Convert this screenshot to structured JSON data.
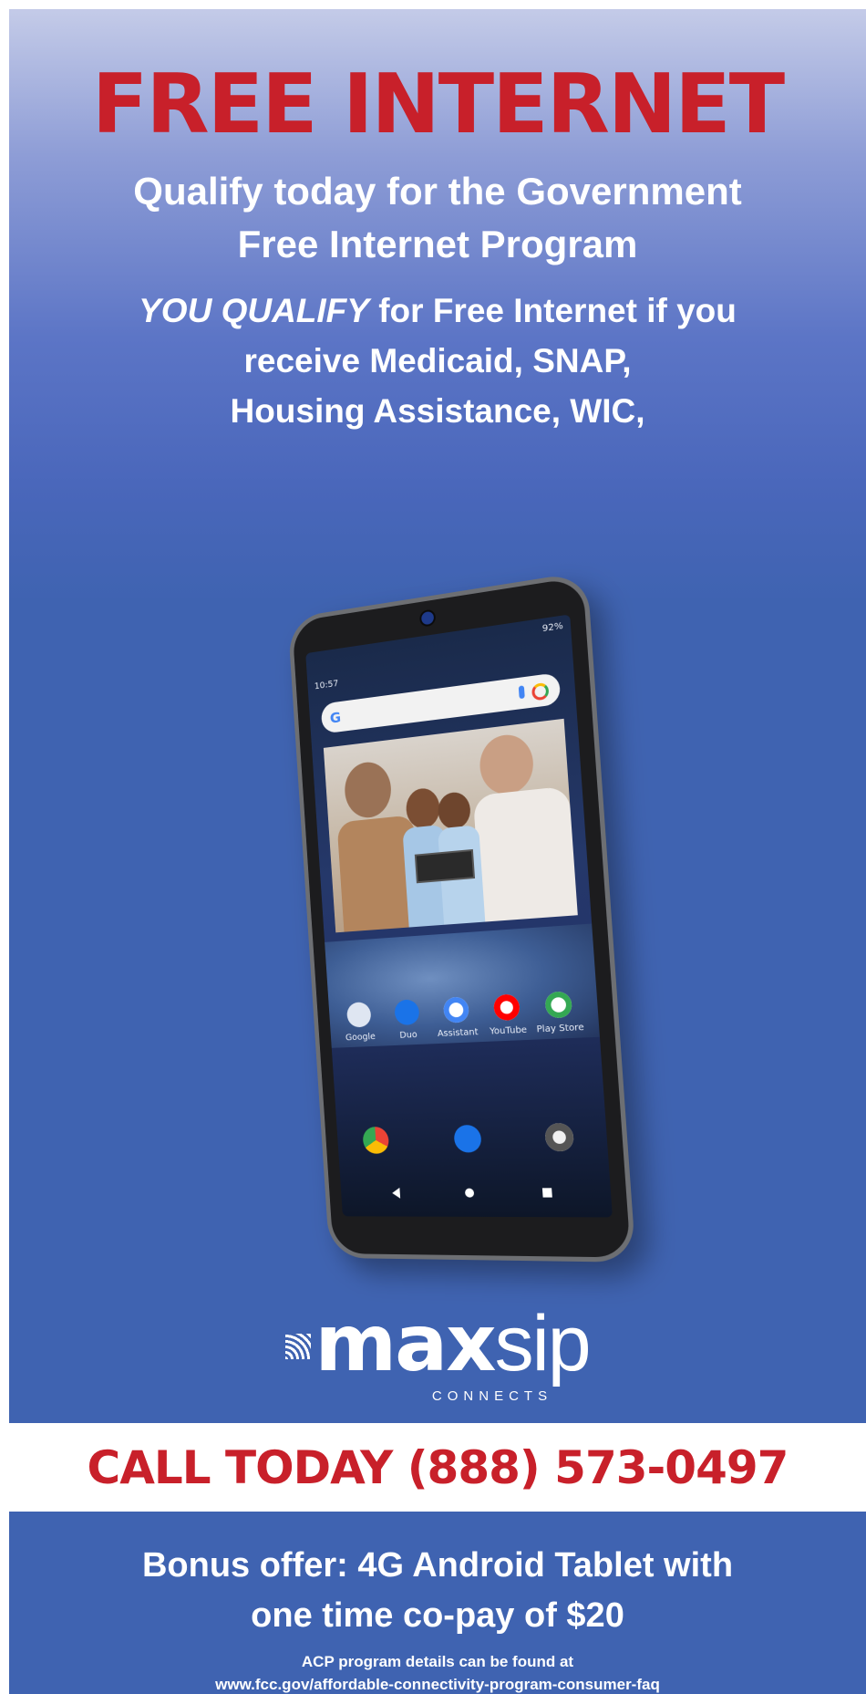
{
  "headline": "FREE INTERNET",
  "subheadline": {
    "line1": "Qualify today for the Government",
    "line2": "Free Internet Program"
  },
  "qualify": {
    "emphasis": "YOU QUALIFY",
    "line1_rest": " for Free Internet if you",
    "line2": "receive Medicaid, SNAP,",
    "line3": "Housing Assistance, WIC,"
  },
  "tablet": {
    "status_time": "10:57",
    "status_battery": "92%",
    "apps": [
      "Google",
      "Duo",
      "Assistant",
      "YouTube",
      "Play Store"
    ],
    "app_colors": [
      "#ea4335",
      "#1a73e8",
      "#4285f4",
      "#ff0000",
      "#34a853"
    ]
  },
  "brand": {
    "name_bold": "max",
    "name_light": "sip",
    "tagline": "CONNECTS"
  },
  "call_to_action": "CALL TODAY (888) 573-0497",
  "bonus": {
    "line1": "Bonus offer: 4G Android Tablet with",
    "line2": "one time co-pay of $20"
  },
  "fine_print": {
    "line1": "ACP program details can be found at",
    "line2": "www.fcc.gov/affordable-connectivity-program-consumer-faq"
  },
  "colors": {
    "headline_red": "#c8202a",
    "background_blue": "#3f63b1",
    "text_white": "#ffffff"
  }
}
